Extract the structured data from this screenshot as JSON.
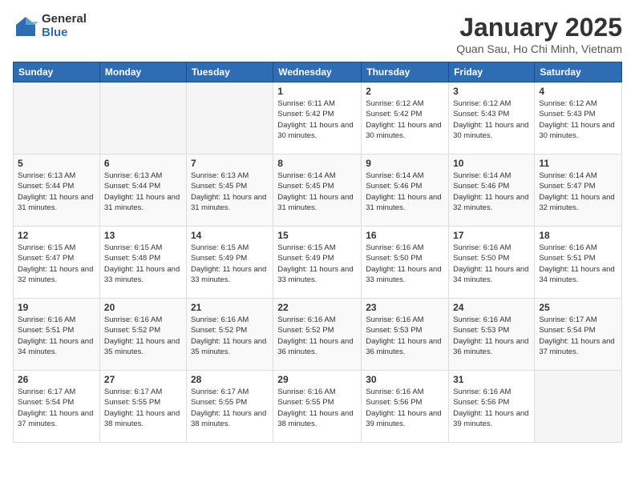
{
  "logo": {
    "general": "General",
    "blue": "Blue"
  },
  "title": {
    "month": "January 2025",
    "location": "Quan Sau, Ho Chi Minh, Vietnam"
  },
  "days_of_week": [
    "Sunday",
    "Monday",
    "Tuesday",
    "Wednesday",
    "Thursday",
    "Friday",
    "Saturday"
  ],
  "weeks": [
    [
      {
        "day": "",
        "sunrise": "",
        "sunset": "",
        "daylight": ""
      },
      {
        "day": "",
        "sunrise": "",
        "sunset": "",
        "daylight": ""
      },
      {
        "day": "",
        "sunrise": "",
        "sunset": "",
        "daylight": ""
      },
      {
        "day": "1",
        "sunrise": "Sunrise: 6:11 AM",
        "sunset": "Sunset: 5:42 PM",
        "daylight": "Daylight: 11 hours and 30 minutes."
      },
      {
        "day": "2",
        "sunrise": "Sunrise: 6:12 AM",
        "sunset": "Sunset: 5:42 PM",
        "daylight": "Daylight: 11 hours and 30 minutes."
      },
      {
        "day": "3",
        "sunrise": "Sunrise: 6:12 AM",
        "sunset": "Sunset: 5:43 PM",
        "daylight": "Daylight: 11 hours and 30 minutes."
      },
      {
        "day": "4",
        "sunrise": "Sunrise: 6:12 AM",
        "sunset": "Sunset: 5:43 PM",
        "daylight": "Daylight: 11 hours and 30 minutes."
      }
    ],
    [
      {
        "day": "5",
        "sunrise": "Sunrise: 6:13 AM",
        "sunset": "Sunset: 5:44 PM",
        "daylight": "Daylight: 11 hours and 31 minutes."
      },
      {
        "day": "6",
        "sunrise": "Sunrise: 6:13 AM",
        "sunset": "Sunset: 5:44 PM",
        "daylight": "Daylight: 11 hours and 31 minutes."
      },
      {
        "day": "7",
        "sunrise": "Sunrise: 6:13 AM",
        "sunset": "Sunset: 5:45 PM",
        "daylight": "Daylight: 11 hours and 31 minutes."
      },
      {
        "day": "8",
        "sunrise": "Sunrise: 6:14 AM",
        "sunset": "Sunset: 5:45 PM",
        "daylight": "Daylight: 11 hours and 31 minutes."
      },
      {
        "day": "9",
        "sunrise": "Sunrise: 6:14 AM",
        "sunset": "Sunset: 5:46 PM",
        "daylight": "Daylight: 11 hours and 31 minutes."
      },
      {
        "day": "10",
        "sunrise": "Sunrise: 6:14 AM",
        "sunset": "Sunset: 5:46 PM",
        "daylight": "Daylight: 11 hours and 32 minutes."
      },
      {
        "day": "11",
        "sunrise": "Sunrise: 6:14 AM",
        "sunset": "Sunset: 5:47 PM",
        "daylight": "Daylight: 11 hours and 32 minutes."
      }
    ],
    [
      {
        "day": "12",
        "sunrise": "Sunrise: 6:15 AM",
        "sunset": "Sunset: 5:47 PM",
        "daylight": "Daylight: 11 hours and 32 minutes."
      },
      {
        "day": "13",
        "sunrise": "Sunrise: 6:15 AM",
        "sunset": "Sunset: 5:48 PM",
        "daylight": "Daylight: 11 hours and 33 minutes."
      },
      {
        "day": "14",
        "sunrise": "Sunrise: 6:15 AM",
        "sunset": "Sunset: 5:49 PM",
        "daylight": "Daylight: 11 hours and 33 minutes."
      },
      {
        "day": "15",
        "sunrise": "Sunrise: 6:15 AM",
        "sunset": "Sunset: 5:49 PM",
        "daylight": "Daylight: 11 hours and 33 minutes."
      },
      {
        "day": "16",
        "sunrise": "Sunrise: 6:16 AM",
        "sunset": "Sunset: 5:50 PM",
        "daylight": "Daylight: 11 hours and 33 minutes."
      },
      {
        "day": "17",
        "sunrise": "Sunrise: 6:16 AM",
        "sunset": "Sunset: 5:50 PM",
        "daylight": "Daylight: 11 hours and 34 minutes."
      },
      {
        "day": "18",
        "sunrise": "Sunrise: 6:16 AM",
        "sunset": "Sunset: 5:51 PM",
        "daylight": "Daylight: 11 hours and 34 minutes."
      }
    ],
    [
      {
        "day": "19",
        "sunrise": "Sunrise: 6:16 AM",
        "sunset": "Sunset: 5:51 PM",
        "daylight": "Daylight: 11 hours and 34 minutes."
      },
      {
        "day": "20",
        "sunrise": "Sunrise: 6:16 AM",
        "sunset": "Sunset: 5:52 PM",
        "daylight": "Daylight: 11 hours and 35 minutes."
      },
      {
        "day": "21",
        "sunrise": "Sunrise: 6:16 AM",
        "sunset": "Sunset: 5:52 PM",
        "daylight": "Daylight: 11 hours and 35 minutes."
      },
      {
        "day": "22",
        "sunrise": "Sunrise: 6:16 AM",
        "sunset": "Sunset: 5:52 PM",
        "daylight": "Daylight: 11 hours and 36 minutes."
      },
      {
        "day": "23",
        "sunrise": "Sunrise: 6:16 AM",
        "sunset": "Sunset: 5:53 PM",
        "daylight": "Daylight: 11 hours and 36 minutes."
      },
      {
        "day": "24",
        "sunrise": "Sunrise: 6:16 AM",
        "sunset": "Sunset: 5:53 PM",
        "daylight": "Daylight: 11 hours and 36 minutes."
      },
      {
        "day": "25",
        "sunrise": "Sunrise: 6:17 AM",
        "sunset": "Sunset: 5:54 PM",
        "daylight": "Daylight: 11 hours and 37 minutes."
      }
    ],
    [
      {
        "day": "26",
        "sunrise": "Sunrise: 6:17 AM",
        "sunset": "Sunset: 5:54 PM",
        "daylight": "Daylight: 11 hours and 37 minutes."
      },
      {
        "day": "27",
        "sunrise": "Sunrise: 6:17 AM",
        "sunset": "Sunset: 5:55 PM",
        "daylight": "Daylight: 11 hours and 38 minutes."
      },
      {
        "day": "28",
        "sunrise": "Sunrise: 6:17 AM",
        "sunset": "Sunset: 5:55 PM",
        "daylight": "Daylight: 11 hours and 38 minutes."
      },
      {
        "day": "29",
        "sunrise": "Sunrise: 6:16 AM",
        "sunset": "Sunset: 5:55 PM",
        "daylight": "Daylight: 11 hours and 38 minutes."
      },
      {
        "day": "30",
        "sunrise": "Sunrise: 6:16 AM",
        "sunset": "Sunset: 5:56 PM",
        "daylight": "Daylight: 11 hours and 39 minutes."
      },
      {
        "day": "31",
        "sunrise": "Sunrise: 6:16 AM",
        "sunset": "Sunset: 5:56 PM",
        "daylight": "Daylight: 11 hours and 39 minutes."
      },
      {
        "day": "",
        "sunrise": "",
        "sunset": "",
        "daylight": ""
      }
    ]
  ]
}
